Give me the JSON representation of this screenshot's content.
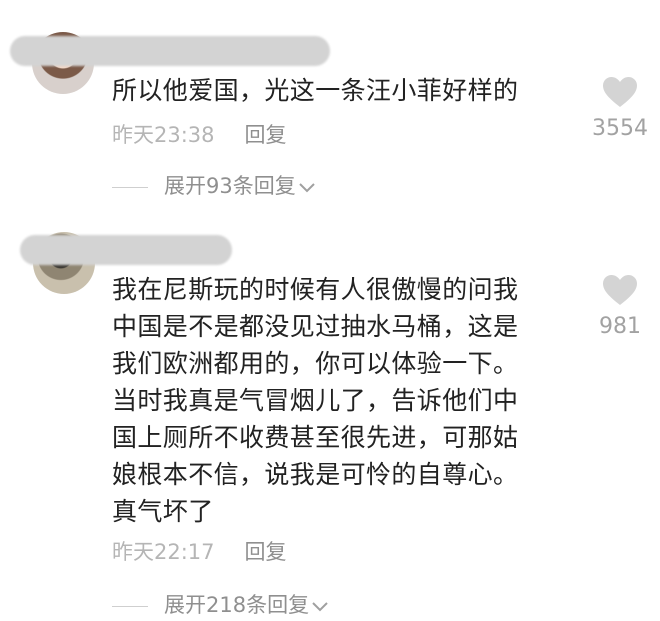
{
  "comments": [
    {
      "text": "所以他爱国，光这一条汪小菲好样的",
      "time": "昨天23:38",
      "reply_label": "回复",
      "likes": "3554",
      "expand_label": "展开93条回复"
    },
    {
      "text": "我在尼斯玩的时候有人很傲慢的问我\n中国是不是都没见过抽水马桶，这是\n我们欧洲都用的，你可以体验一下。\n当时我真是气冒烟儿了，告诉他们中\n国上厕所不收费甚至很先进，可那姑\n娘根本不信，说我是可怜的自尊心。\n真气坏了",
      "time": "昨天22:17",
      "reply_label": "回复",
      "likes": "981",
      "expand_label": "展开218条回复"
    }
  ],
  "colors": {
    "text": "#222222",
    "meta": "#b5b5b5",
    "link": "#8f8f8f",
    "heart": "#d4d4d4"
  },
  "icons": [
    "heart-icon",
    "chevron-down-icon"
  ]
}
